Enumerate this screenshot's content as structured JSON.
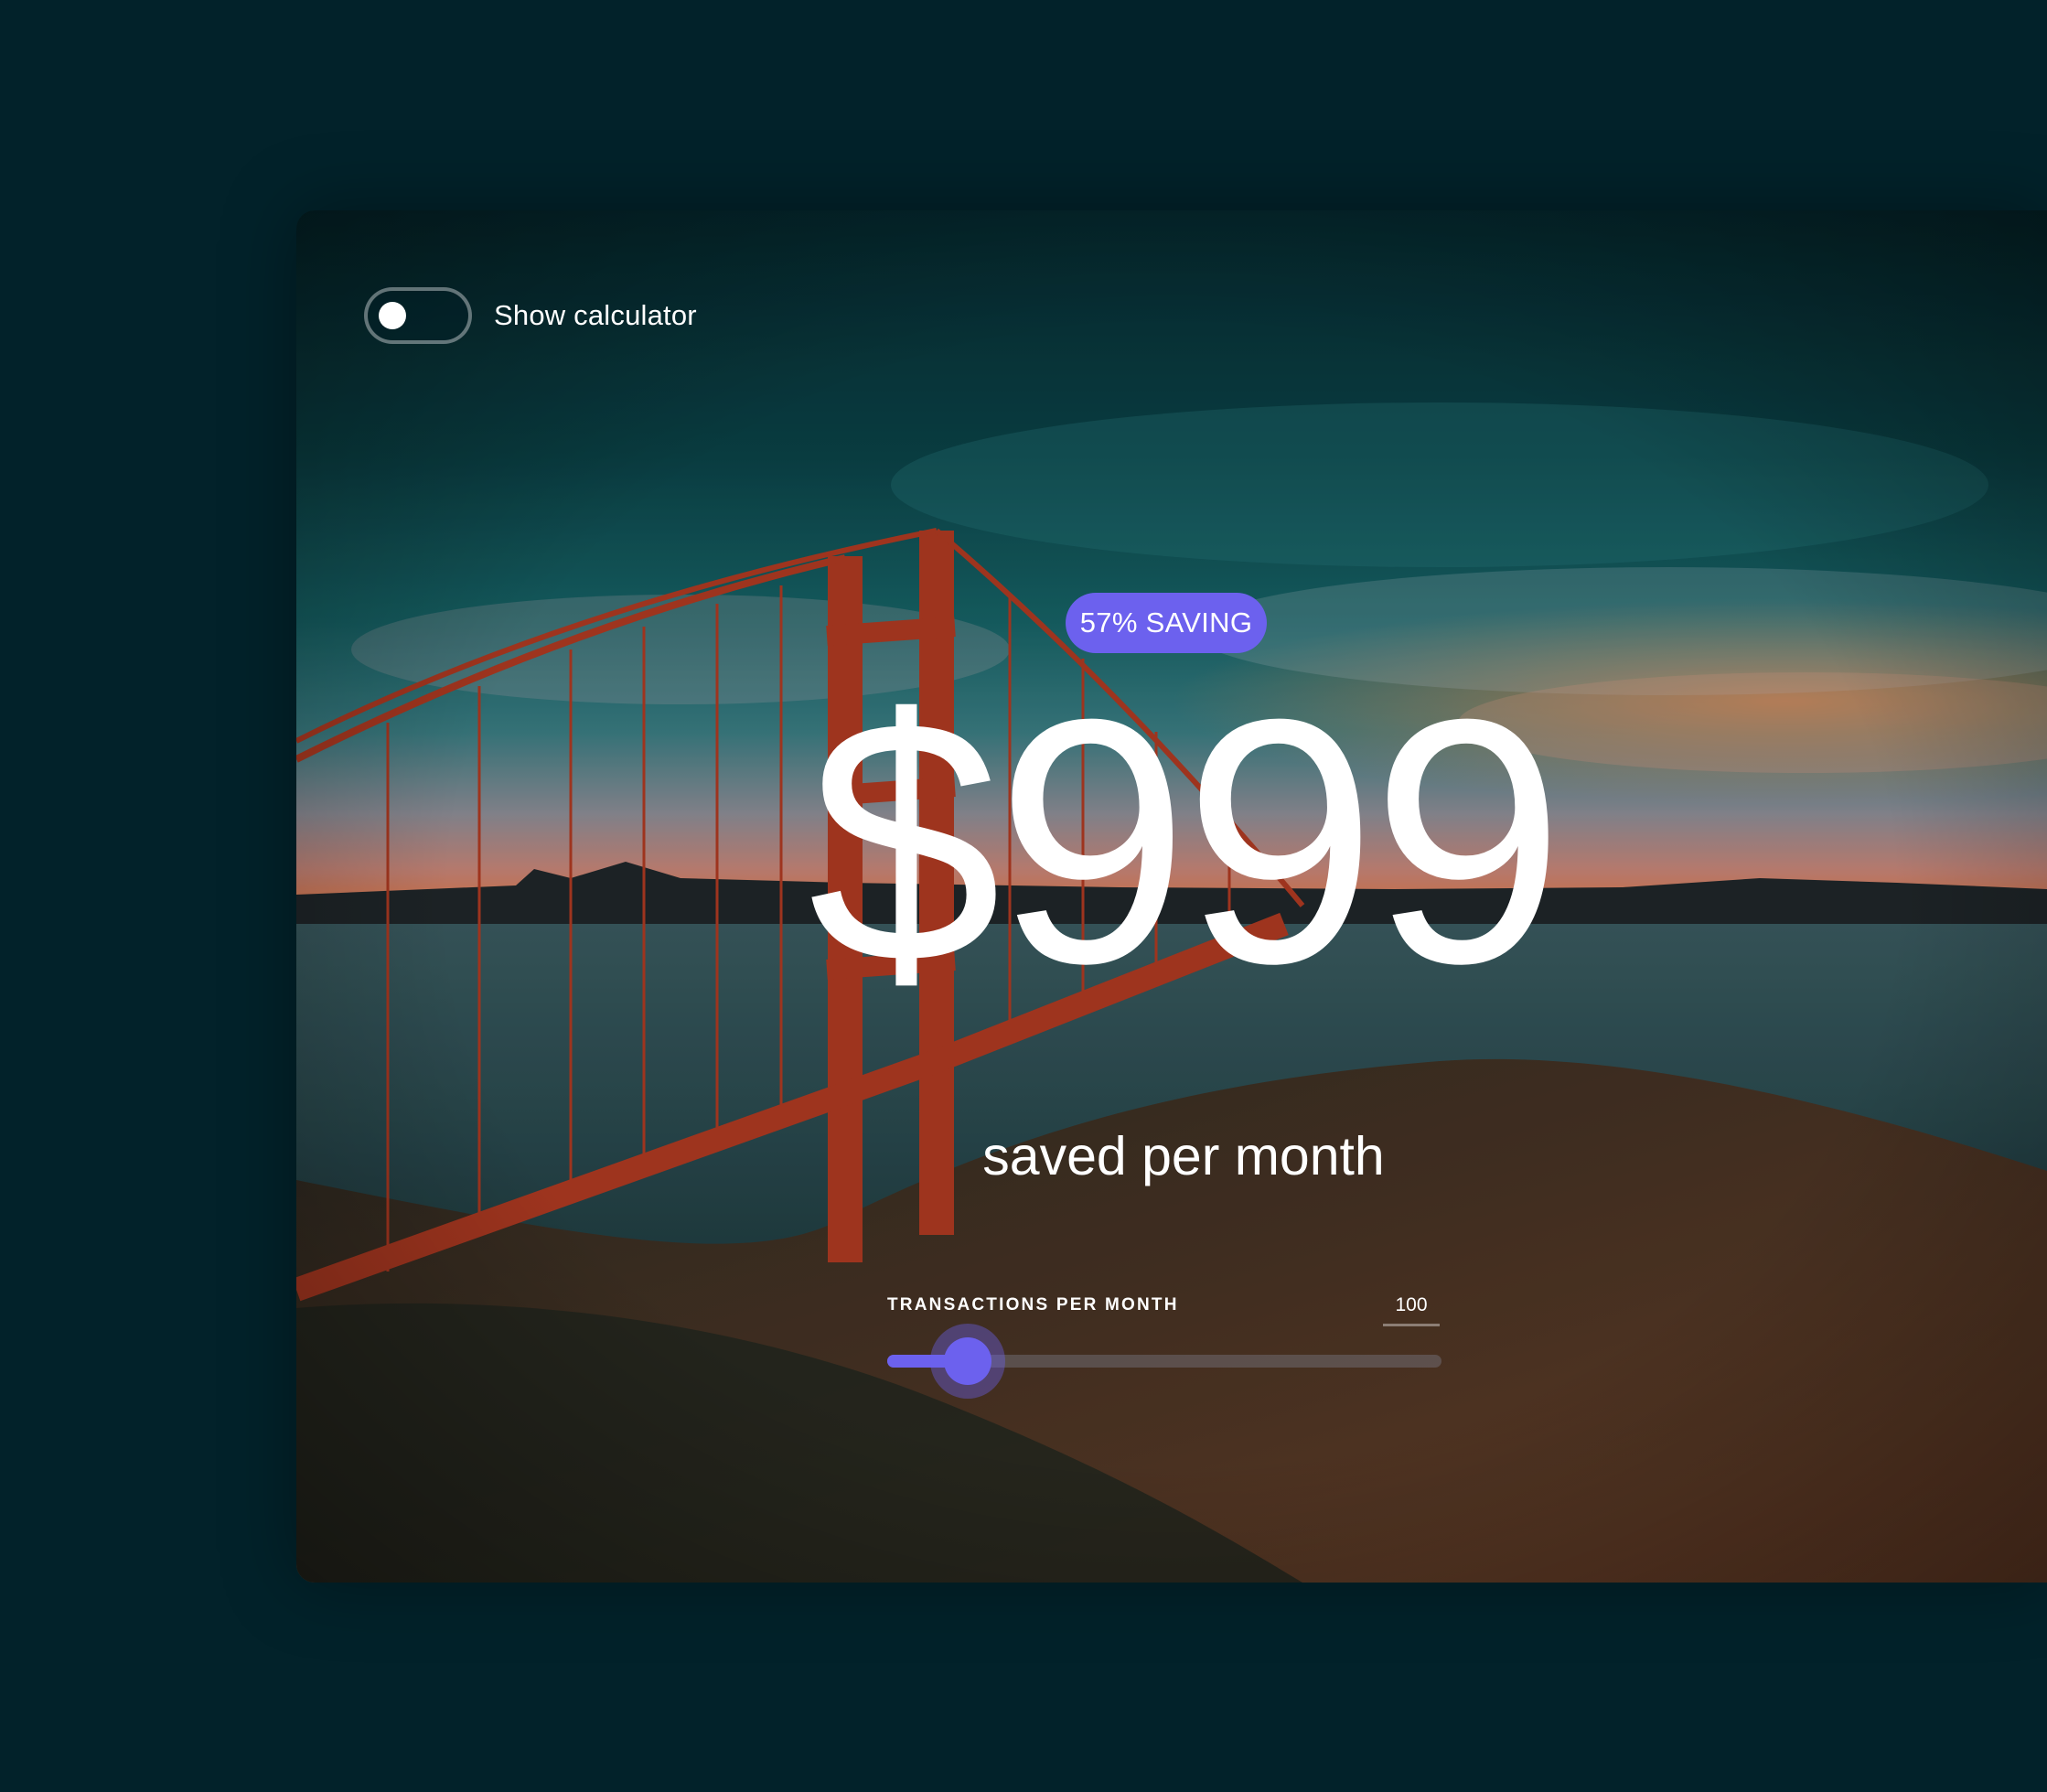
{
  "toggle": {
    "label": "Show calculator",
    "on": false
  },
  "badge": {
    "text": "57% SAVING"
  },
  "savings": {
    "amount": "$999",
    "caption": "saved per month"
  },
  "slider": {
    "label": "TRANSACTIONS PER MONTH",
    "value": "100",
    "fraction": 0.145
  },
  "colors": {
    "background": "#02222a",
    "accent": "#6c61ee",
    "text": "#ffffff"
  },
  "background_image": "golden-gate-bridge-sunset-photo"
}
